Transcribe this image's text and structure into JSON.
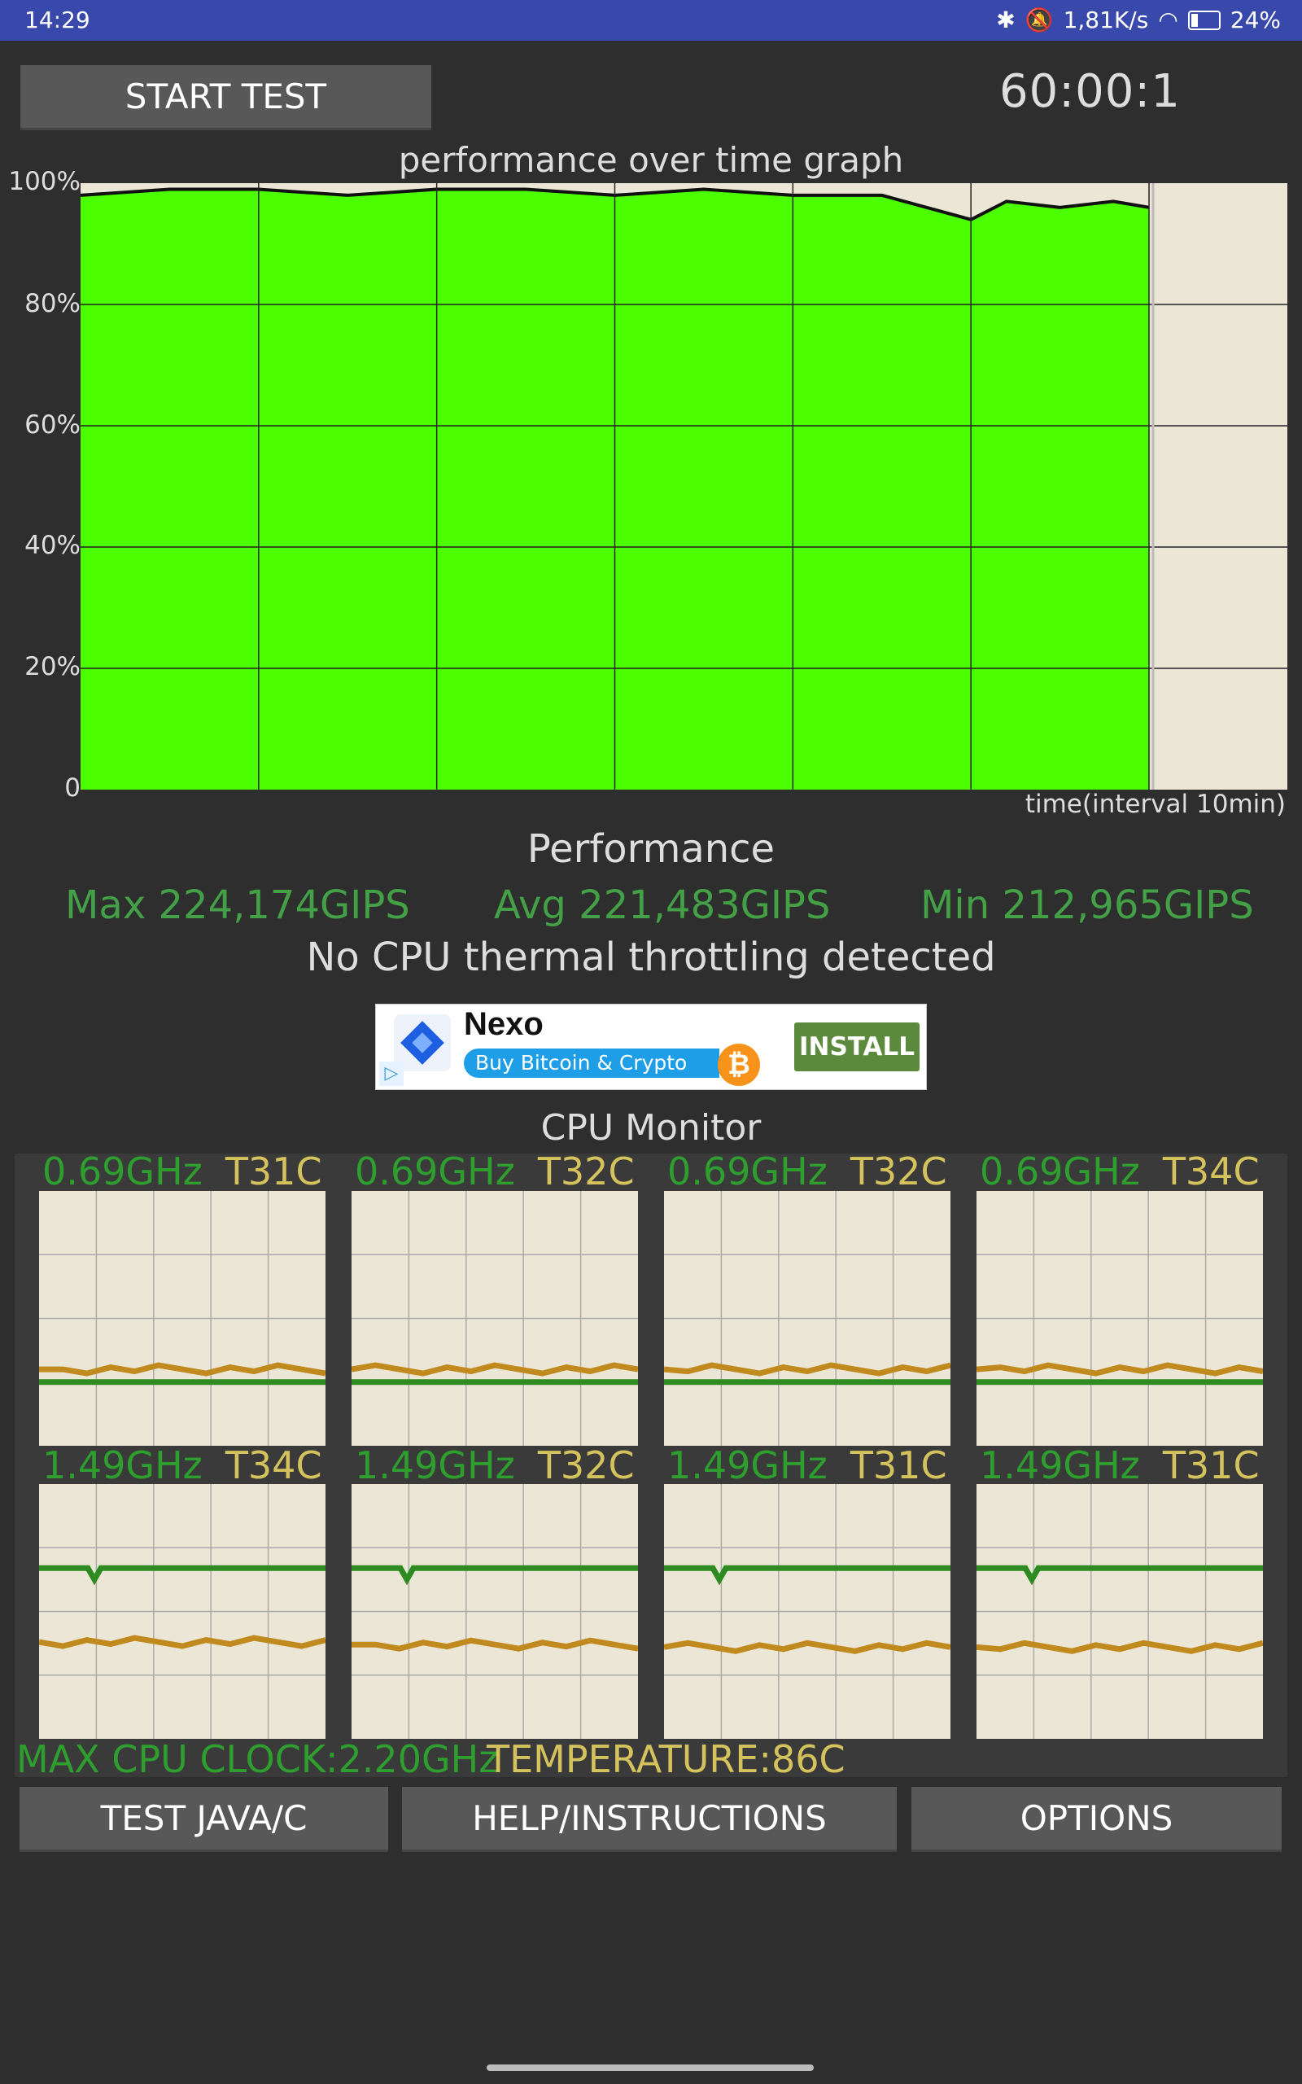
{
  "status_bar": {
    "time": "14:29",
    "net_speed": "1,81K/s",
    "battery": "24%",
    "icons": [
      "bluetooth-icon",
      "mute-icon",
      "wifi-icon",
      "battery-icon"
    ]
  },
  "header": {
    "start_label": "START TEST",
    "timer": "60:00:1"
  },
  "graph": {
    "title": "performance over time graph",
    "y_ticks": [
      "100%",
      "80%",
      "60%",
      "40%",
      "20%",
      "0"
    ],
    "x_label": "time(interval 10min)",
    "fill_color": "#4cff00",
    "background_color": "#ebe6d6"
  },
  "chart_data": {
    "type": "area",
    "title": "performance over time graph",
    "xlabel": "time(interval 10min)",
    "ylabel": "",
    "ylim": [
      0,
      100
    ],
    "y_ticks": [
      "0",
      "20%",
      "40%",
      "60%",
      "80%",
      "100%"
    ],
    "x": [
      0,
      5,
      10,
      15,
      20,
      25,
      30,
      35,
      40,
      45,
      50,
      52,
      55,
      58,
      60
    ],
    "values": [
      98,
      99,
      99,
      98,
      99,
      99,
      98,
      99,
      98,
      98,
      94,
      97,
      96,
      97,
      96
    ],
    "grid": true
  },
  "performance": {
    "title": "Performance",
    "max": "Max 224,174GIPS",
    "avg": "Avg 221,483GIPS",
    "min": "Min 212,965GIPS",
    "throttle_msg": "No CPU thermal throttling detected"
  },
  "ad": {
    "brand": "Nexo",
    "tagline": "Buy Bitcoin & Crypto",
    "cta": "INSTALL"
  },
  "cpu_monitor": {
    "title": "CPU Monitor",
    "cores": [
      {
        "freq": "0.69GHz",
        "temp": "T31C",
        "freq_level": 0.25,
        "temp_level": 0.3
      },
      {
        "freq": "0.69GHz",
        "temp": "T32C",
        "freq_level": 0.25,
        "temp_level": 0.3
      },
      {
        "freq": "0.69GHz",
        "temp": "T32C",
        "freq_level": 0.25,
        "temp_level": 0.3
      },
      {
        "freq": "0.69GHz",
        "temp": "T34C",
        "freq_level": 0.25,
        "temp_level": 0.3
      },
      {
        "freq": "1.49GHz",
        "temp": "T34C",
        "freq_level": 0.67,
        "temp_level": 0.38
      },
      {
        "freq": "1.49GHz",
        "temp": "T32C",
        "freq_level": 0.67,
        "temp_level": 0.37
      },
      {
        "freq": "1.49GHz",
        "temp": "T31C",
        "freq_level": 0.67,
        "temp_level": 0.36
      },
      {
        "freq": "1.49GHz",
        "temp": "T31C",
        "freq_level": 0.67,
        "temp_level": 0.36
      }
    ],
    "max_clock": "MAX CPU CLOCK:2.20GHz",
    "temperature": "TEMPERATURE:86C"
  },
  "buttons": {
    "test_java": "TEST JAVA/C",
    "help": "HELP/INSTRUCTIONS",
    "options": "OPTIONS"
  }
}
